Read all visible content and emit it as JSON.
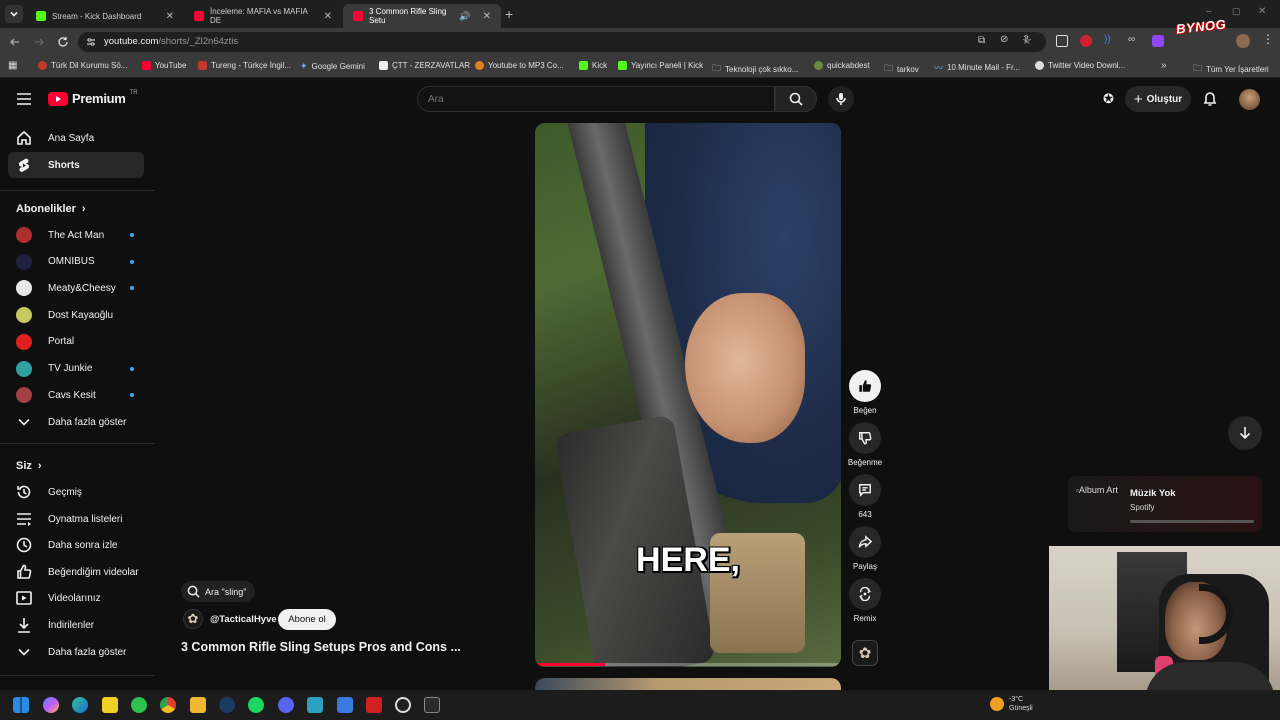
{
  "tabs": [
    {
      "title": "Stream - Kick Dashboard",
      "color": "#53fc18"
    },
    {
      "title": "İnceleme: MAFIA vs MAFIA DE",
      "color": "#ff0033"
    },
    {
      "title": "3 Common Rifle Sling Setu",
      "color": "#ff0033"
    }
  ],
  "address": {
    "host": "youtube.com",
    "path": "/shorts/_Zl2n64ztis"
  },
  "bookmarks": [
    "Türk Dil Kurumu Sö...",
    "YouTube",
    "Tureng - Türkçe İngil...",
    "Google Gemini",
    "ÇTT - ZERZAVATLAR",
    "Youtube to MP3 Co...",
    "Kick",
    "Yayıncı Paneli | Kick",
    "Teknoloji çok sıkko...",
    "quickabdest",
    "tarkov",
    "10 Minute Mail - Fr...",
    "Twitter Video Downl..."
  ],
  "bookmarks_all": "Tüm Yer İşaretleri",
  "yt": {
    "logo_text": "Premium",
    "logo_region": "TR",
    "search_placeholder": "Ara",
    "create_label": "Oluştur"
  },
  "sidebar": {
    "home": "Ana Sayfa",
    "shorts": "Shorts",
    "subs_title": "Abonelikler",
    "subscriptions": [
      {
        "name": "The Act Man",
        "color": "#b03030",
        "dot": true
      },
      {
        "name": "OMNIBUS",
        "color": "#202040",
        "dot": true
      },
      {
        "name": "Meaty&Cheesy",
        "color": "#e8e8e8",
        "dot": true
      },
      {
        "name": "Dost Kayaoğlu",
        "color": "#c8c860",
        "dot": false
      },
      {
        "name": "Portal",
        "color": "#e02020",
        "dot": false
      },
      {
        "name": "TV Junkie",
        "color": "#30a0a0",
        "dot": true
      },
      {
        "name": "Cavs Kesit",
        "color": "#a04040",
        "dot": true
      }
    ],
    "show_more": "Daha fazla göster",
    "you_title": "Siz",
    "you_items": [
      "Geçmiş",
      "Oynatma listeleri",
      "Daha sonra izle",
      "Beğendiğim videolar",
      "Videolarınız",
      "İndirilenler"
    ],
    "you_more": "Daha fazla göster"
  },
  "short": {
    "search_chip": "Ara \"sling\"",
    "channel": "@TacticalHyve",
    "subscribe": "Abone ol",
    "title": "3 Common Rifle Sling Setups Pros and Cons ...",
    "caption": "HERE,",
    "progress": 0.23
  },
  "actions": {
    "like": "Beğen",
    "dislike": "Beğenme",
    "comments": "643",
    "share": "Paylaş",
    "remix": "Remix"
  },
  "music_widget": {
    "art_alt": "Album Art",
    "title": "Müzik Yok",
    "source": "Spotify"
  },
  "overlay_logo": "BYNOG",
  "weather": {
    "temp": "-3°C",
    "desc": "Güneşli"
  }
}
